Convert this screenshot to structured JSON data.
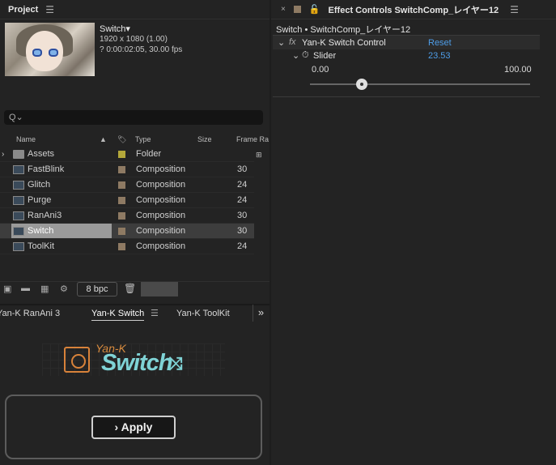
{
  "project": {
    "tab_title": "Project",
    "comp_name": "Switch▾",
    "resolution": "1920 x 1080 (1.00)",
    "duration": "? 0:00:02:05, 30.00 fps",
    "search_placeholder": "Q⌄",
    "columns": [
      "Name",
      "Type",
      "Size",
      "Frame Ra"
    ],
    "items": [
      {
        "name": "Assets",
        "type": "Folder",
        "fr": "",
        "kind": "folder"
      },
      {
        "name": "FastBlink",
        "type": "Composition",
        "fr": "30",
        "kind": "comp"
      },
      {
        "name": "Glitch",
        "type": "Composition",
        "fr": "24",
        "kind": "comp"
      },
      {
        "name": "Purge",
        "type": "Composition",
        "fr": "24",
        "kind": "comp"
      },
      {
        "name": "RanAni3",
        "type": "Composition",
        "fr": "30",
        "kind": "comp"
      },
      {
        "name": "Switch",
        "type": "Composition",
        "fr": "30",
        "kind": "comp",
        "selected": true
      },
      {
        "name": "ToolKit",
        "type": "Composition",
        "fr": "24",
        "kind": "comp"
      }
    ],
    "bpc": "8 bpc"
  },
  "tabs": [
    "Yan-K RanAni 3",
    "Yan-K Switch",
    "Yan-K ToolKit"
  ],
  "plugin": {
    "logo_top": "Yan-K",
    "logo_main": "Switch",
    "apply_label": "Apply"
  },
  "effect_controls": {
    "tab_title": "Effect Controls SwitchComp_レイヤー12",
    "subtitle": "Switch • SwitchComp_レイヤー12",
    "effect_name": "Yan-K Switch Control",
    "reset_label": "Reset",
    "param_name": "Slider",
    "param_value": "23.53",
    "range_min": "0.00",
    "range_max": "100.00",
    "slider_fraction": 0.2353
  },
  "colors": {
    "accent_blue": "#4e9de8",
    "label_tan": "#8e7a63",
    "label_yellow": "#b3a73a",
    "logo_orange": "#d8823a",
    "logo_cyan": "#7fd3d6"
  }
}
